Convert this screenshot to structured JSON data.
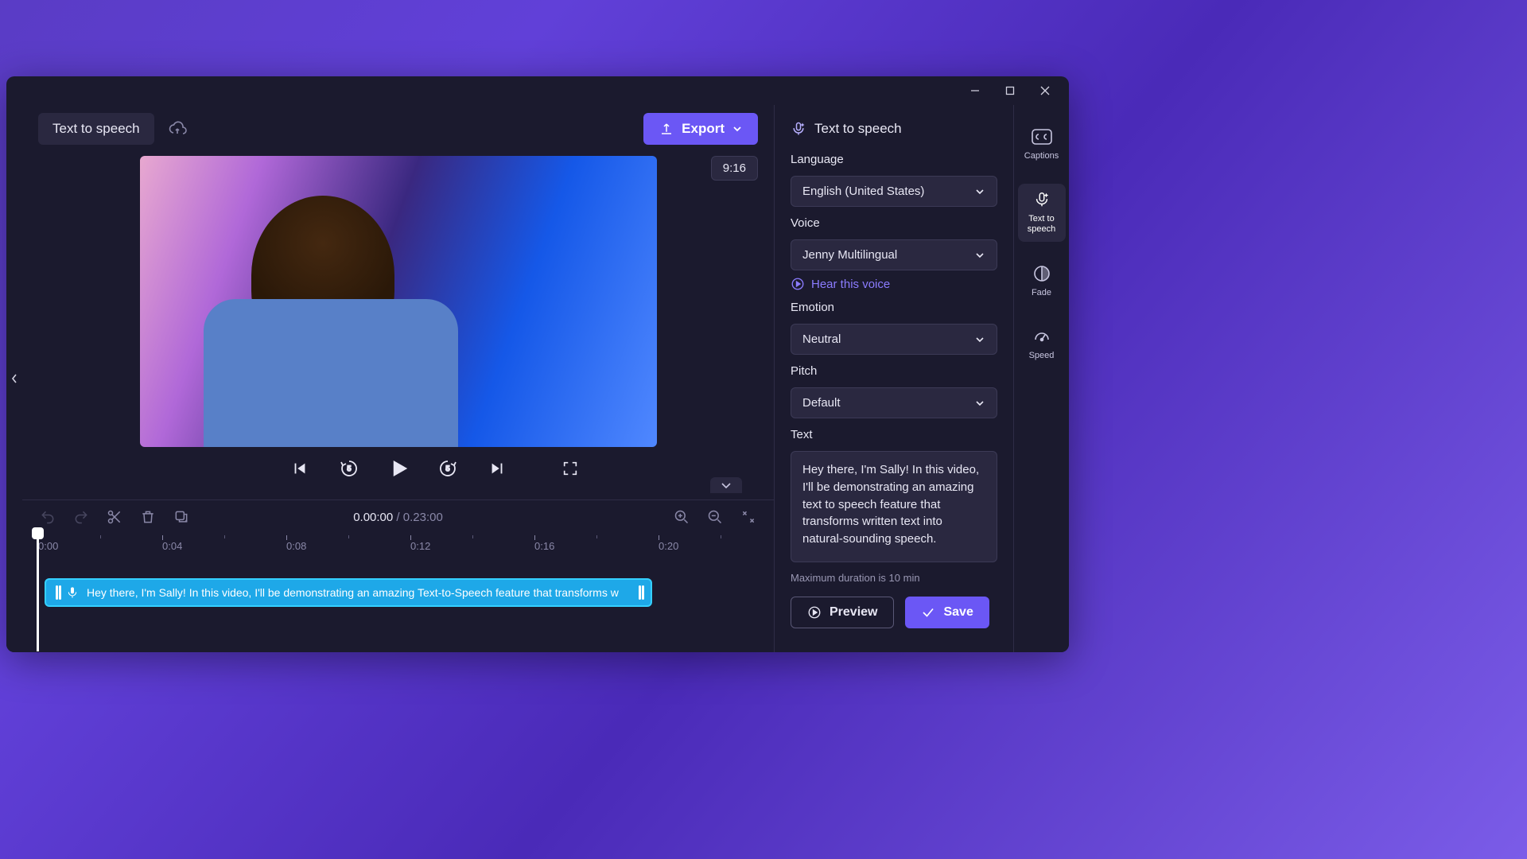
{
  "topbar": {
    "page_title": "Text to speech",
    "export_label": "Export"
  },
  "preview": {
    "aspect_badge": "9:16"
  },
  "timeline": {
    "current": "0.00:00",
    "separator": "/",
    "duration": "0.23:00",
    "ticks": [
      "0:00",
      "0:04",
      "0:08",
      "0:12",
      "0:16",
      "0:20"
    ],
    "clip_text": "Hey there, I'm Sally! In this video, I'll be demonstrating an amazing Text-to-Speech feature that transforms w"
  },
  "panel": {
    "title": "Text to speech",
    "language_label": "Language",
    "language_value": "English (United States)",
    "voice_label": "Voice",
    "voice_value": "Jenny Multilingual",
    "hear_label": "Hear this voice",
    "emotion_label": "Emotion",
    "emotion_value": "Neutral",
    "pitch_label": "Pitch",
    "pitch_value": "Default",
    "text_label": "Text",
    "text_value": "Hey there, I'm Sally! In this video, I'll be demonstrating an amazing text to speech feature that transforms written text into natural-sounding speech.",
    "hint": "Maximum duration is 10 min",
    "preview_btn": "Preview",
    "save_btn": "Save"
  },
  "rail": {
    "captions": "Captions",
    "tts": "Text to speech",
    "fade": "Fade",
    "speed": "Speed"
  }
}
